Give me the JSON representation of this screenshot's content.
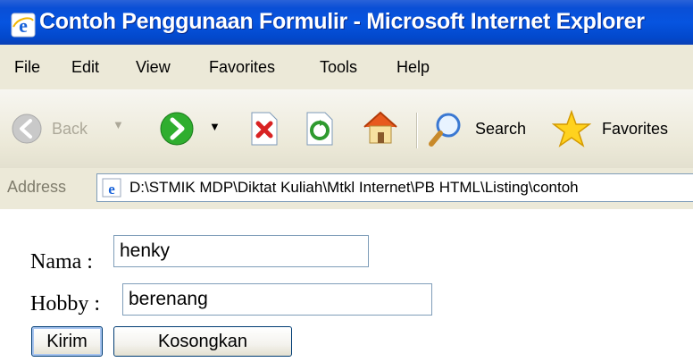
{
  "window": {
    "title": "Contoh Penggunaan Formulir - Microsoft Internet Explorer"
  },
  "menu": {
    "items": [
      "File",
      "Edit",
      "View",
      "Favorites",
      "Tools",
      "Help"
    ]
  },
  "toolbar": {
    "back_label": "Back",
    "search_label": "Search",
    "favorites_label": "Favorites"
  },
  "address": {
    "label": "Address",
    "value": "D:\\STMIK MDP\\Diktat Kuliah\\Mtkl Internet\\PB HTML\\Listing\\contoh"
  },
  "form": {
    "nama_label": "Nama :",
    "nama_value": "henky",
    "hobby_label": "Hobby :",
    "hobby_value": "berenang",
    "submit_label": "Kirim",
    "reset_label": "Kosongkan"
  },
  "colors": {
    "titlebar": "#0654e0",
    "chrome": "#ece9d8",
    "input_border": "#7f9db9"
  }
}
